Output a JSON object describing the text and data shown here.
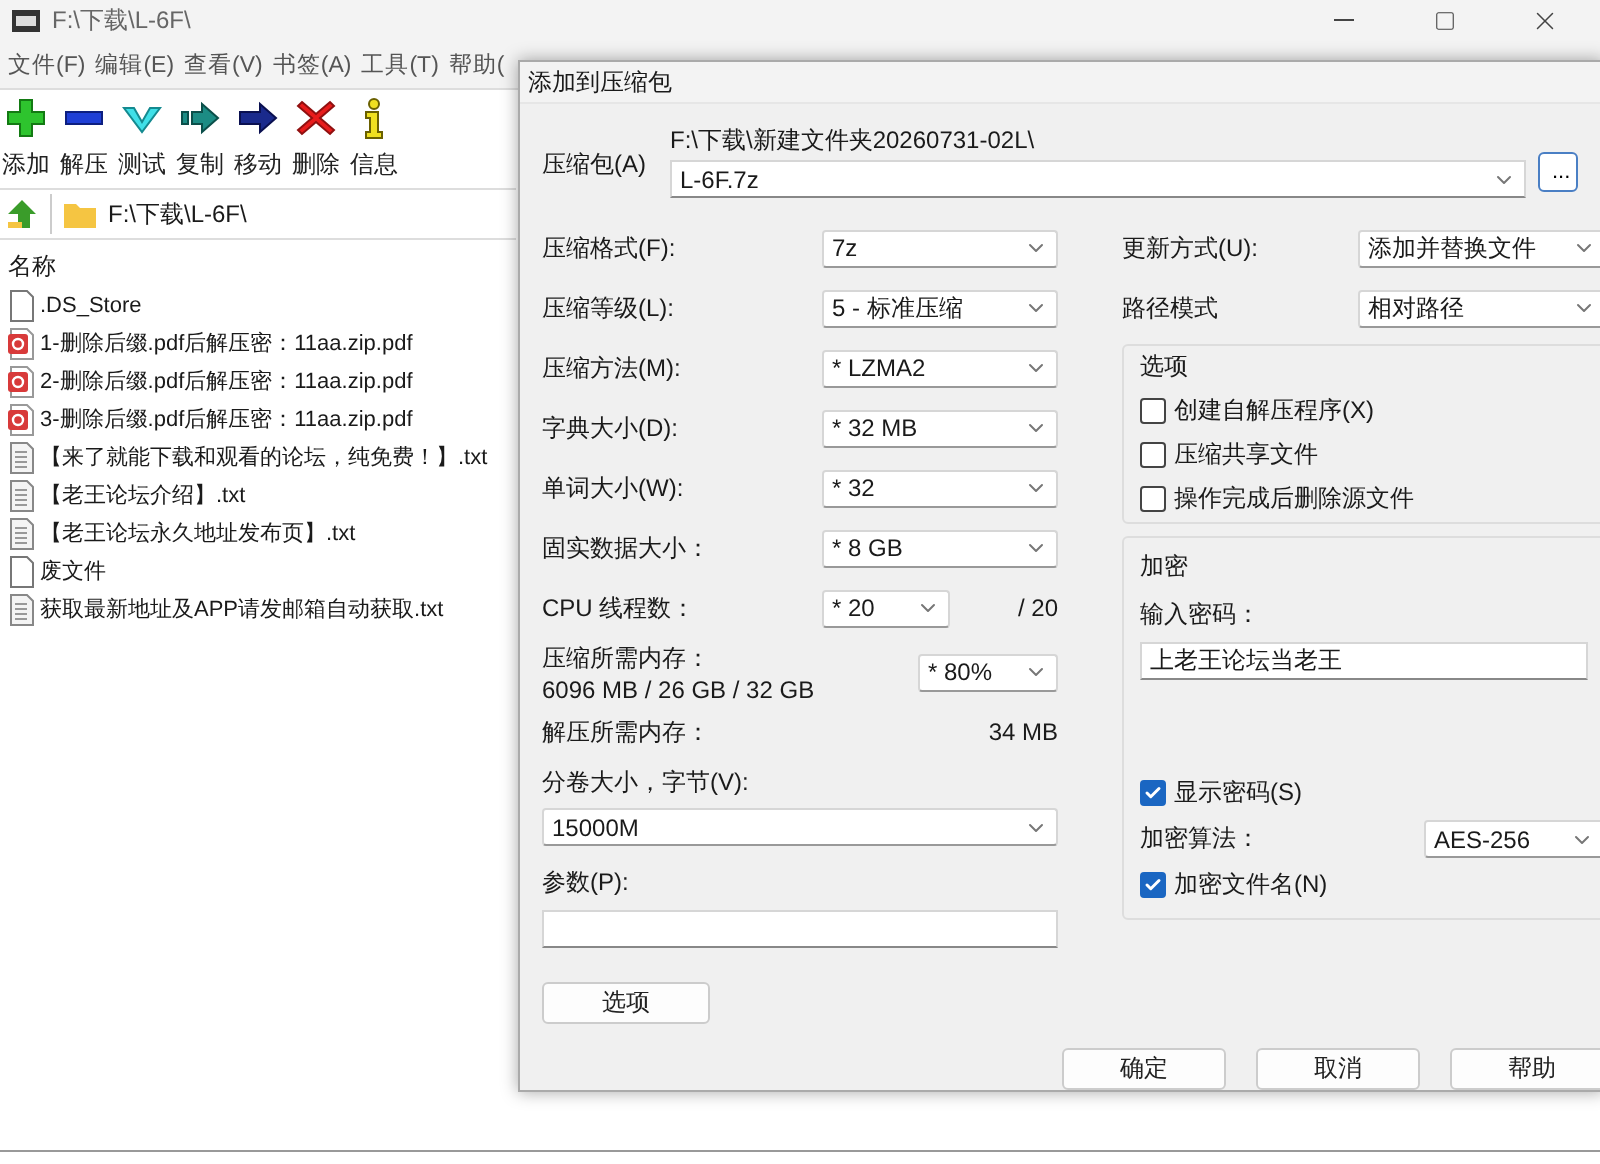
{
  "main_window": {
    "title": "F:\\下载\\L-6F\\",
    "menu": [
      "文件(F)",
      "编辑(E)",
      "查看(V)",
      "书签(A)",
      "工具(T)",
      "帮助("
    ],
    "toolbar": [
      {
        "label": "添加",
        "kind": "add"
      },
      {
        "label": "解压",
        "kind": "extract"
      },
      {
        "label": "测试",
        "kind": "test"
      },
      {
        "label": "复制",
        "kind": "copy"
      },
      {
        "label": "移动",
        "kind": "move"
      },
      {
        "label": "删除",
        "kind": "delete"
      },
      {
        "label": "信息",
        "kind": "info"
      }
    ],
    "path": "F:\\下载\\L-6F\\",
    "column_header": "名称",
    "files": [
      {
        "name": ".DS_Store",
        "kind": "blank"
      },
      {
        "name": "1-删除后缀.pdf后解压密：11aa.zip.pdf",
        "kind": "pdf"
      },
      {
        "name": "2-删除后缀.pdf后解压密：11aa.zip.pdf",
        "kind": "pdf"
      },
      {
        "name": "3-删除后缀.pdf后解压密：11aa.zip.pdf",
        "kind": "pdf"
      },
      {
        "name": "【来了就能下载和观看的论坛，纯免费！】.txt",
        "kind": "text"
      },
      {
        "name": "【老王论坛介绍】.txt",
        "kind": "text"
      },
      {
        "name": "【老王论坛永久地址发布页】.txt",
        "kind": "text"
      },
      {
        "name": "废文件",
        "kind": "blank"
      },
      {
        "name": "获取最新地址及APP请发邮箱自动获取.txt",
        "kind": "text"
      }
    ]
  },
  "dialog": {
    "title": "添加到压缩包",
    "archive": {
      "label": "压缩包(A)",
      "folder": "F:\\下载\\新建文件夹20260731-02L\\",
      "value": "L-6F.7z",
      "browse": "..."
    },
    "settings": [
      {
        "label": "压缩格式(F):",
        "value": "7z"
      },
      {
        "label": "压缩等级(L):",
        "value": "5 - 标准压缩"
      },
      {
        "label": "压缩方法(M):",
        "value": "*  LZMA2"
      },
      {
        "label": "字典大小(D):",
        "value": "*  32 MB"
      },
      {
        "label": "单词大小(W):",
        "value": "*  32"
      },
      {
        "label": "固实数据大小：",
        "value": "*  8 GB"
      }
    ],
    "cpu": {
      "label": "CPU 线程数：",
      "value": "*  20",
      "max": "/ 20"
    },
    "memory": {
      "label": "压缩所需内存：",
      "detail": "6096 MB / 26 GB / 32 GB",
      "value": "*  80%"
    },
    "decompress": {
      "label": "解压所需内存：",
      "value": "34 MB"
    },
    "volume": {
      "label": "分卷大小，字节(V):",
      "value": "15000M"
    },
    "params": {
      "label": "参数(P):"
    },
    "options_button": "选项",
    "update": {
      "label": "更新方式(U):",
      "value": "添加并替换文件"
    },
    "path_mode": {
      "label": "路径模式",
      "value": "相对路径"
    },
    "options_group": {
      "title": "选项",
      "items": [
        {
          "label": "创建自解压程序(X)",
          "checked": false
        },
        {
          "label": "压缩共享文件",
          "checked": false
        },
        {
          "label": "操作完成后删除源文件",
          "checked": false
        }
      ]
    },
    "encryption": {
      "title": "加密",
      "password_label": "输入密码：",
      "password": "上老王论坛当老王",
      "show_password": {
        "label": "显示密码(S)",
        "checked": true
      },
      "method_label": "加密算法：",
      "method": "AES-256",
      "encrypt_names": {
        "label": "加密文件名(N)",
        "checked": true
      }
    },
    "buttons": [
      "确定",
      "取消",
      "帮助"
    ]
  }
}
